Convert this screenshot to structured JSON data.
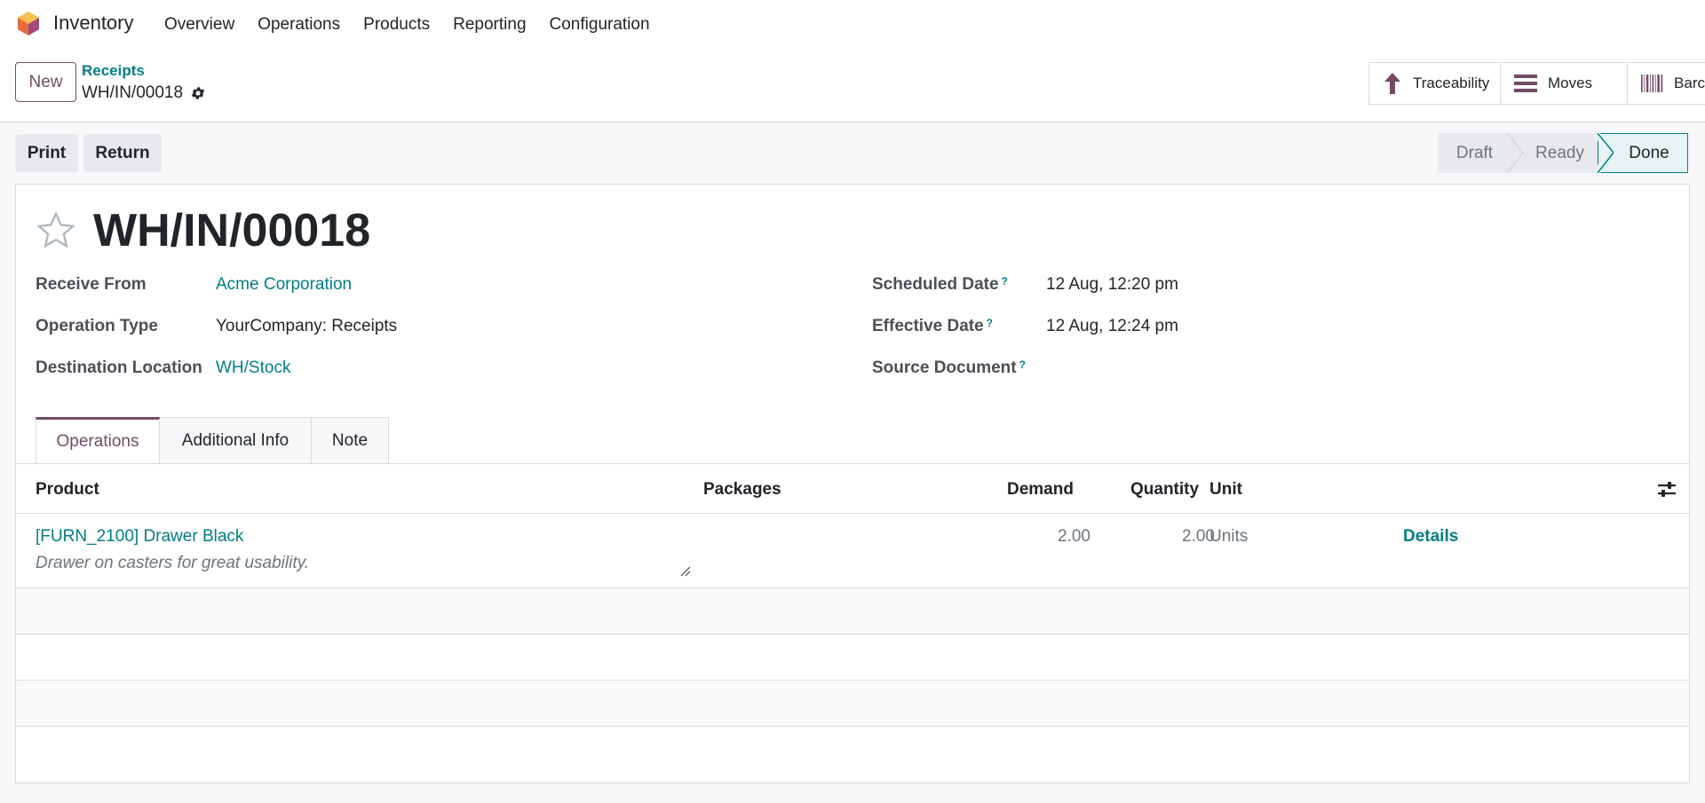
{
  "navbar": {
    "app_name": "Inventory",
    "menu": [
      "Overview",
      "Operations",
      "Products",
      "Reporting",
      "Configuration"
    ]
  },
  "control": {
    "new_label": "New",
    "breadcrumb_parent": "Receipts",
    "breadcrumb_current": "WH/IN/00018",
    "smart_buttons": [
      "Traceability",
      "Moves",
      "Barc"
    ]
  },
  "actions": {
    "print_label": "Print",
    "return_label": "Return"
  },
  "status": {
    "stages": [
      "Draft",
      "Ready",
      "Done"
    ],
    "current": "Done"
  },
  "record": {
    "title": "WH/IN/00018",
    "fields_left": [
      {
        "label": "Receive From",
        "value": "Acme Corporation"
      },
      {
        "label": "Operation Type",
        "value": "YourCompany: Receipts"
      },
      {
        "label": "Destination Location",
        "value": "WH/Stock"
      }
    ],
    "fields_right": [
      {
        "label": "Scheduled Date",
        "value": "12 Aug, 12:20 pm"
      },
      {
        "label": "Effective Date",
        "value": "12 Aug, 12:24 pm"
      },
      {
        "label": "Source Document",
        "value": ""
      }
    ],
    "help_mark": "?"
  },
  "tabs": [
    "Operations",
    "Additional Info",
    "Note"
  ],
  "table": {
    "headers": {
      "product": "Product",
      "packages": "Packages",
      "demand": "Demand",
      "quantity": "Quantity",
      "unit": "Unit"
    },
    "rows": [
      {
        "product": "[FURN_2100] Drawer Black",
        "description": "Drawer on casters for great usability.",
        "packages": "",
        "demand": "2.00",
        "quantity": "2.00",
        "unit": "Units",
        "action": "Details"
      }
    ]
  },
  "colors": {
    "brand": "#714b67",
    "link": "#017e84"
  }
}
